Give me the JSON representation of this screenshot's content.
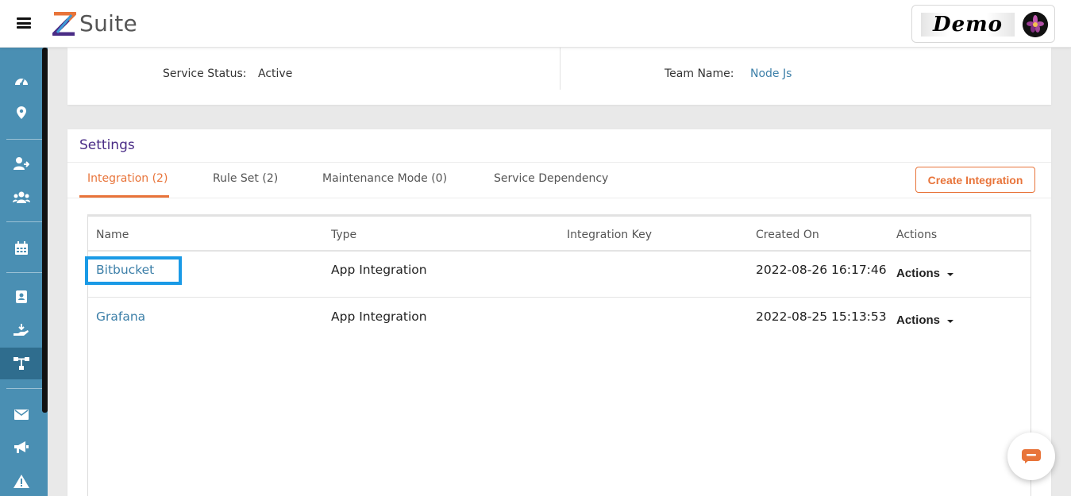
{
  "header": {
    "brand_letter": "Z",
    "brand_name": "Suite",
    "user_badge": "Demo",
    "colors": {
      "brand_orange": "#e8743a",
      "brand_purple": "#4a2c86",
      "sidebar": "#4a8fb3"
    }
  },
  "sidebar": {
    "items": [
      {
        "icon": "dashboard-icon"
      },
      {
        "icon": "location-pin-icon"
      },
      {
        "icon": "user-arrow-icon"
      },
      {
        "icon": "users-group-icon"
      },
      {
        "icon": "calendar-icon"
      },
      {
        "icon": "contact-book-icon"
      },
      {
        "icon": "hand-receive-icon"
      },
      {
        "icon": "sitemap-icon",
        "active": true
      },
      {
        "icon": "envelope-icon"
      },
      {
        "icon": "megaphone-icon"
      },
      {
        "icon": "warning-icon"
      }
    ]
  },
  "service_info": {
    "status_label": "Service Status:",
    "status_value": "Active",
    "team_label": "Team Name:",
    "team_value": "Node Js"
  },
  "settings": {
    "title": "Settings",
    "tabs": [
      {
        "label": "Integration (2)",
        "active": true
      },
      {
        "label": "Rule Set (2)"
      },
      {
        "label": "Maintenance Mode (0)"
      },
      {
        "label": "Service Dependency"
      }
    ],
    "create_button": "Create Integration"
  },
  "table": {
    "columns": [
      "Name",
      "Type",
      "Integration Key",
      "Created On",
      "Actions"
    ],
    "rows": [
      {
        "name": "Bitbucket",
        "type": "App Integration",
        "key": "",
        "created": "2022-08-26 16:17:46",
        "actions": "Actions"
      },
      {
        "name": "Grafana",
        "type": "App Integration",
        "key": "",
        "created": "2022-08-25 15:13:53",
        "actions": "Actions"
      }
    ]
  },
  "chat": {
    "icon": "chat-bubble-icon"
  }
}
